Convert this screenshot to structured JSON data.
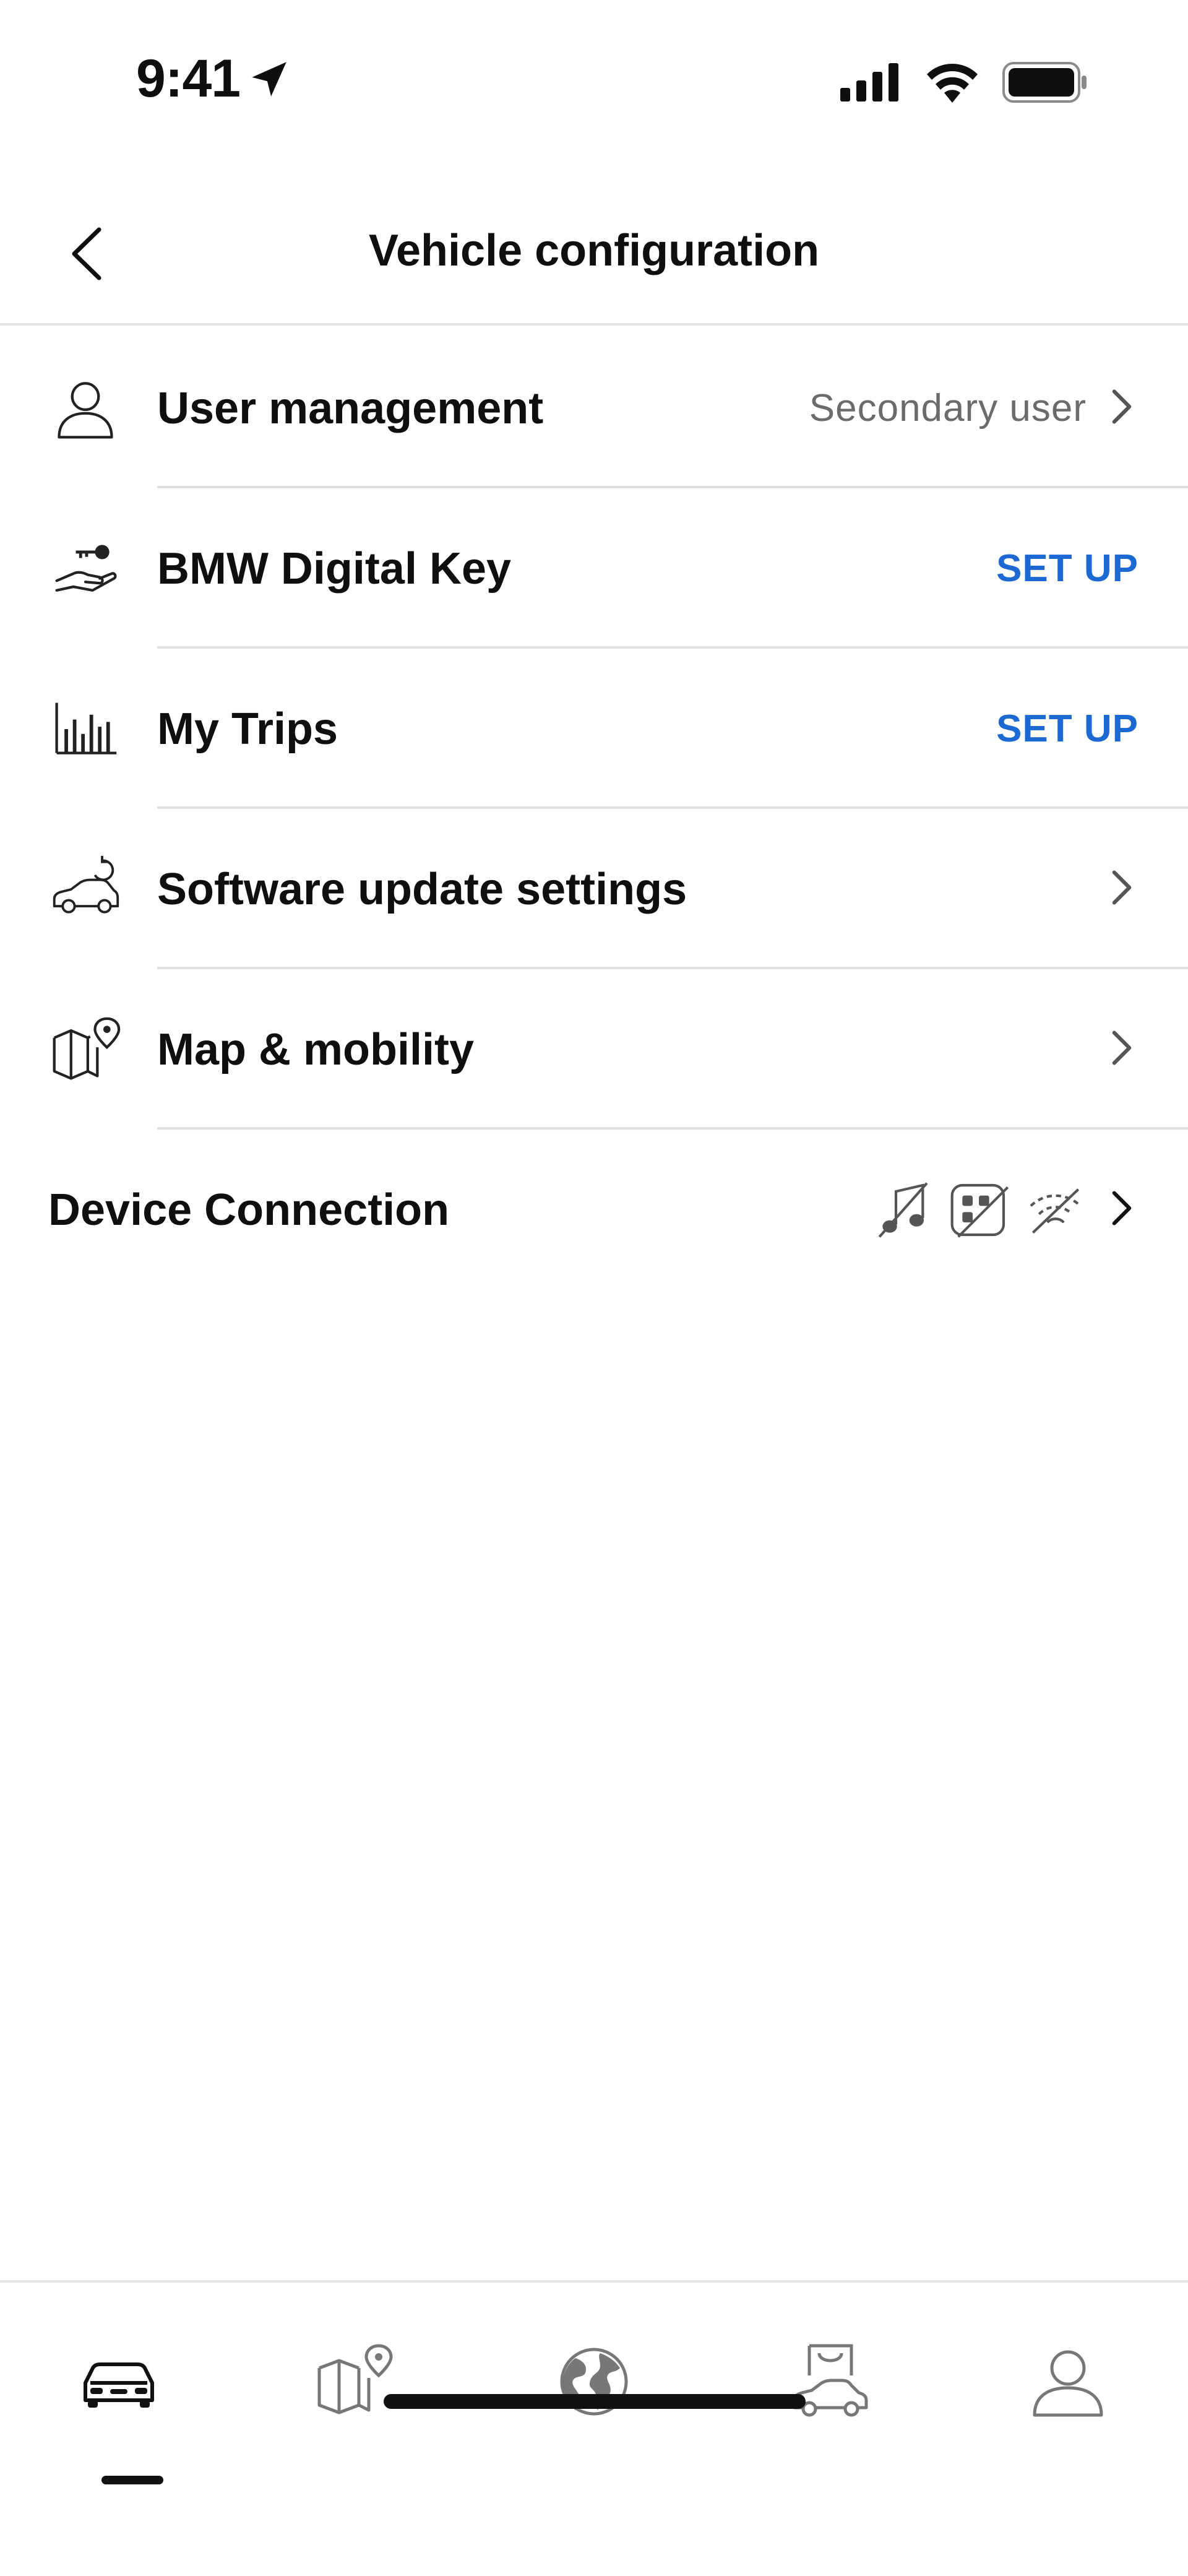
{
  "status_bar": {
    "time": "9:41"
  },
  "header": {
    "title": "Vehicle configuration"
  },
  "items": [
    {
      "label": "User management",
      "value": "Secondary user",
      "icon": "user-icon"
    },
    {
      "label": "BMW Digital Key",
      "action": "SET UP",
      "icon": "digital-key-icon"
    },
    {
      "label": "My Trips",
      "action": "SET UP",
      "icon": "trips-chart-icon"
    },
    {
      "label": "Software update settings",
      "icon": "car-update-icon"
    },
    {
      "label": "Map & mobility",
      "icon": "map-pin-icon"
    },
    {
      "label": "Device Connection",
      "icons": [
        "music-off-icon",
        "apps-off-icon",
        "wifi-off-icon"
      ]
    }
  ],
  "tabs": [
    {
      "name": "car-tab",
      "icon": "car-icon",
      "active": true
    },
    {
      "name": "map-tab",
      "icon": "map-pin-icon",
      "active": false
    },
    {
      "name": "globe-tab",
      "icon": "globe-icon",
      "active": false
    },
    {
      "name": "shop-tab",
      "icon": "shop-car-icon",
      "active": false
    },
    {
      "name": "profile-tab",
      "icon": "profile-icon",
      "active": false
    }
  ],
  "colors": {
    "accent": "#1c69d4",
    "text": "#0f0f0f",
    "secondary": "#6b6b6b",
    "divider": "#e0e0e0"
  }
}
